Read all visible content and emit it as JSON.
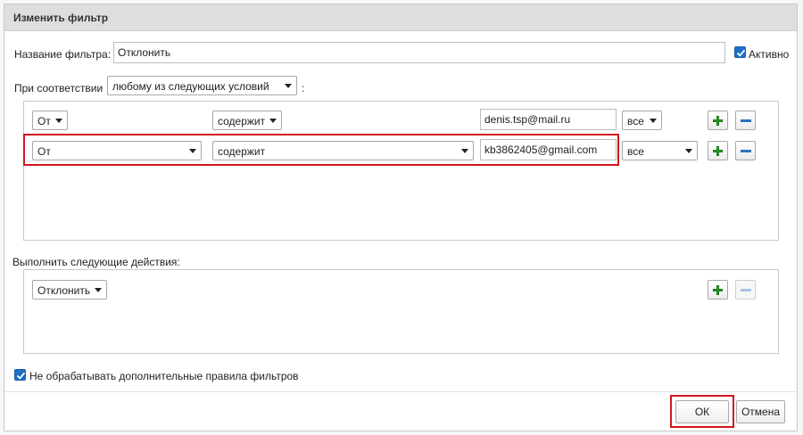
{
  "dialog": {
    "title": "Изменить фильтр"
  },
  "filter": {
    "name_label": "Название фильтра:",
    "name_value": "Отклонить",
    "active_label": "Активно",
    "active_checked": true
  },
  "match": {
    "label": "При соответствии",
    "selected": "любому из следующих условий",
    "suffix": ":"
  },
  "conditions": [
    {
      "field": "От",
      "operator": "содержит",
      "value": "denis.tsp@mail.ru",
      "scope": "все"
    },
    {
      "field": "От",
      "operator": "содержит",
      "value": "kb3862405@gmail.com",
      "scope": "все"
    }
  ],
  "actions": {
    "label": "Выполнить следующие действия:",
    "items": [
      {
        "action": "Отклонить"
      }
    ]
  },
  "options": {
    "stop_processing_label": "Не обрабатывать дополнительные правила фильтров",
    "stop_processing_checked": true
  },
  "buttons": {
    "ok": "ОК",
    "cancel": "Отмена"
  },
  "colors": {
    "highlight": "#d4141f",
    "add_icon": "#2aa52a",
    "remove_icon": "#2f6fc0",
    "checkbox": "#1f6fc6"
  }
}
